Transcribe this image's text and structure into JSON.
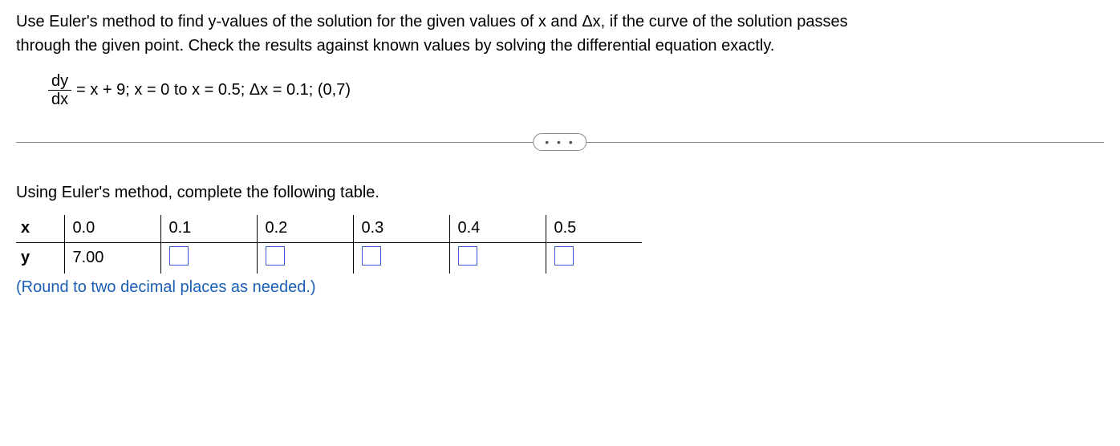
{
  "problem": {
    "line1": "Use Euler's method to find y-values of the solution for the given values of x and Δx, if the curve of the solution passes",
    "line2": "through the given point. Check the results against known values by solving the differential equation exactly.",
    "frac_num": "dy",
    "frac_den": "dx",
    "eq_rest": " = x + 9; x = 0 to x = 0.5; Δx = 0.1; (0,7)"
  },
  "dots": "• • •",
  "instruction": "Using Euler's method, complete the following table.",
  "table": {
    "x_label": "x",
    "y_label": "y",
    "x_values": [
      "0.0",
      "0.1",
      "0.2",
      "0.3",
      "0.4",
      "0.5"
    ],
    "y_initial": "7.00"
  },
  "note": "(Round to two decimal places as needed.)"
}
